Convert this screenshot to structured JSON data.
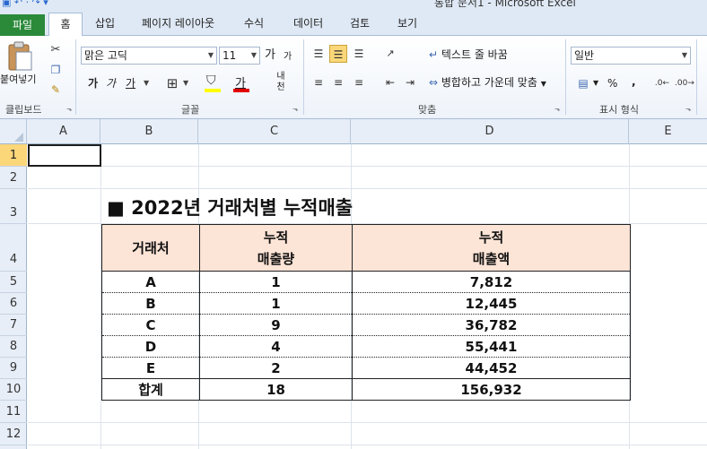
{
  "window": {
    "quick_access": "▣ ↶ · ↷ ▾",
    "title": "통합 문서1 - Microsoft Excel"
  },
  "tabs": [
    "파일",
    "홈",
    "삽입",
    "페이지 레이아웃",
    "수식",
    "데이터",
    "검토",
    "보기"
  ],
  "ribbon": {
    "clipboard": {
      "paste_label": "붙여넣기",
      "group_label": "클립보드"
    },
    "font": {
      "font_name": "맑은 고딕",
      "font_size": "11",
      "grow": "가",
      "shrink": "가",
      "bold": "가",
      "italic": "가",
      "underline": "가",
      "font_color": "가",
      "phonetic": "내천",
      "group_label": "글꼴"
    },
    "alignment": {
      "wrap_text": "텍스트 줄 바꿈",
      "merge_center": "병합하고 가운데 맞춤",
      "group_label": "맞춤"
    },
    "number": {
      "format": "일반",
      "percent": "%",
      "comma": ",",
      "group_label": "표시 형식"
    }
  },
  "columns": [
    "A",
    "B",
    "C",
    "D",
    "E"
  ],
  "rows": [
    "1",
    "2",
    "3",
    "4",
    "5",
    "6",
    "7",
    "8",
    "9",
    "10",
    "11",
    "12"
  ],
  "sheet": {
    "title": "■ 2022년 거래처별 누적매출",
    "headers": {
      "client": "거래처",
      "qty_line1": "누적",
      "qty_line2": "매출량",
      "amt_line1": "누적",
      "amt_line2": "매출액"
    },
    "data": [
      {
        "client": "A",
        "qty": "1",
        "amount": "7,812"
      },
      {
        "client": "B",
        "qty": "1",
        "amount": "12,445"
      },
      {
        "client": "C",
        "qty": "9",
        "amount": "36,782"
      },
      {
        "client": "D",
        "qty": "4",
        "amount": "55,441"
      },
      {
        "client": "E",
        "qty": "2",
        "amount": "44,452"
      }
    ],
    "total": {
      "label": "합계",
      "qty": "18",
      "amount": "156,932"
    }
  },
  "colors": {
    "file_tab": "#2a8a3a",
    "header_fill": "#fce4d6",
    "selection": "#fbd77a"
  }
}
